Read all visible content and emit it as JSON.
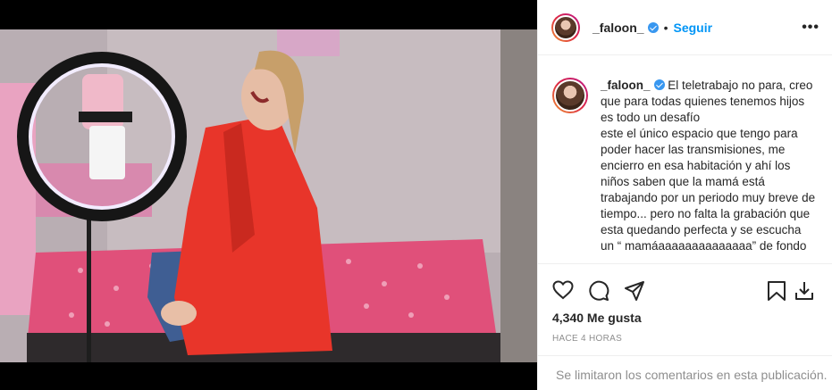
{
  "post": {
    "username": "_faloon_",
    "follow_label": "Seguir",
    "separator": "•",
    "more_label": "•••",
    "caption": "El teletrabajo no para, creo que para todas quienes tenemos hijos es todo un desafío\neste el único espacio que tengo para poder hacer las transmisiones, me encierro en esa habitación y ahí los niños saben que la mamá está trabajando por un periodo muy breve de tiempo... pero no falta la grabación que esta quedando perfecta y se escucha un “ mamáaaaaaaaaaaaaaa” de fondo",
    "likes": "4,340 Me gusta",
    "timestamp": "HACE 4 HORAS",
    "comments_disabled": "Se limitaron los comentarios en esta publicación."
  },
  "icons": {
    "like": "heart-icon",
    "comment": "comment-icon",
    "share": "send-icon",
    "save": "bookmark-icon",
    "upload": "upload-icon",
    "verified": "verified-badge-icon"
  },
  "colors": {
    "accent": "#0095f6",
    "verified": "#3897f0",
    "muted": "#8e8e8e",
    "coat": "#e8352a",
    "bedspread": "#e0507a"
  }
}
